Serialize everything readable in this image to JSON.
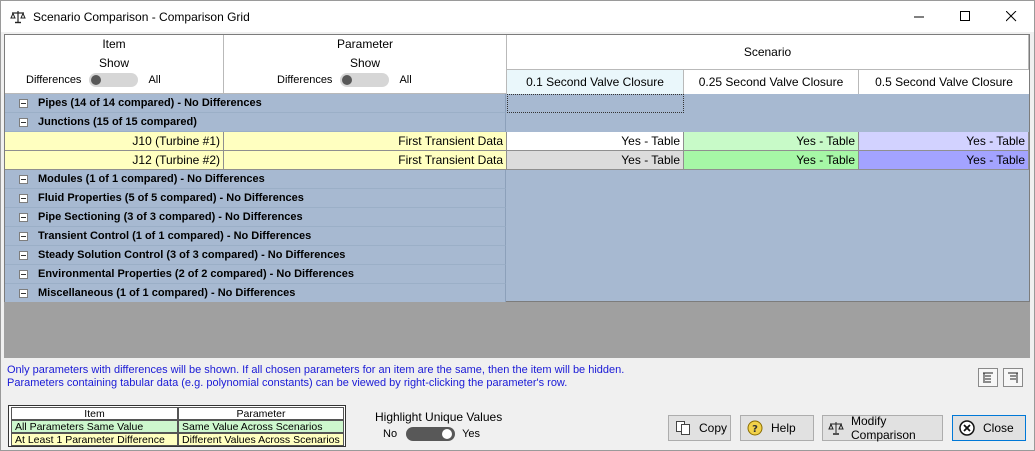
{
  "window": {
    "title": "Scenario Comparison - Comparison Grid",
    "app_icon": "scale-icon",
    "controls": [
      "minimize-icon",
      "maximize-icon",
      "close-icon"
    ]
  },
  "header": {
    "item": {
      "title": "Item",
      "show": "Show",
      "toggle_left": "Differences",
      "toggle_right": "All"
    },
    "parameter": {
      "title": "Parameter",
      "show": "Show",
      "toggle_left": "Differences",
      "toggle_right": "All"
    },
    "scenario": {
      "title": "Scenario",
      "columns": [
        "0.1 Second Valve Closure",
        "0.25 Second Valve Closure",
        "0.5 Second Valve Closure"
      ]
    }
  },
  "rows": {
    "pipes": "Pipes (14 of 14 compared) - No Differences",
    "junctions": "Junctions (15 of 15 compared)",
    "j10": {
      "item": "J10 (Turbine #1)",
      "parameter": "First Transient Data",
      "values": [
        "Yes - Table",
        "Yes - Table",
        "Yes - Table"
      ]
    },
    "j12": {
      "item": "J12 (Turbine #2)",
      "parameter": "First Transient Data",
      "values": [
        "Yes - Table",
        "Yes - Table",
        "Yes - Table"
      ]
    },
    "modules": "Modules (1 of 1 compared) - No Differences",
    "fluid": "Fluid Properties (5 of 5 compared) - No Differences",
    "pipe_sectioning": "Pipe Sectioning (3 of 3 compared) - No Differences",
    "transient": "Transient Control (1 of 1 compared) - No Differences",
    "steady": "Steady Solution Control (3 of 3 compared) - No Differences",
    "environmental": "Environmental Properties (2 of 2 compared) - No Differences",
    "misc": "Miscellaneous (1 of 1 compared) - No Differences"
  },
  "info": {
    "line1": "Only parameters with differences will be shown. If all chosen parameters for an item are the same, then the item will be hidden.",
    "line2": "Parameters containing tabular data (e.g. polynomial constants) can be viewed by right-clicking the parameter's row."
  },
  "legend": {
    "item_header": "Item",
    "parameter_header": "Parameter",
    "item_same": "All Parameters Same Value",
    "item_diff": "At Least 1 Parameter Difference",
    "param_same": "Same Value Across Scenarios",
    "param_diff": "Different Values Across Scenarios"
  },
  "highlight": {
    "title": "Highlight Unique Values",
    "no": "No",
    "yes": "Yes"
  },
  "buttons": {
    "copy": "Copy",
    "help": "Help",
    "modify": "Modify Comparison",
    "close": "Close"
  },
  "colors": {
    "group_bg": "#a7b9d1",
    "item_diff": "#ffffc0",
    "item_same": "#cdf7cd",
    "cell_gray": "#dcdcdc",
    "cell_green": "#a6f7a6",
    "cell_blue": "#a3a3ff",
    "info_text": "#1a1ad6"
  }
}
